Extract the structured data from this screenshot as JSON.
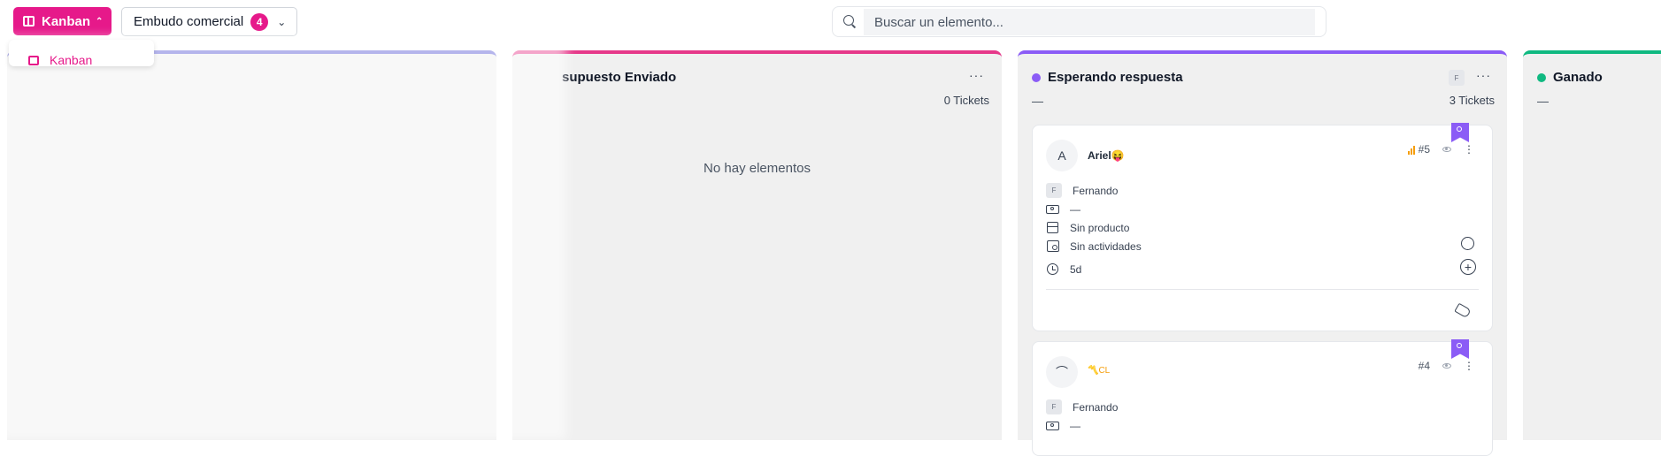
{
  "header": {
    "view_button_label": "Kanban",
    "funnel_label": "Embudo comercial",
    "funnel_count": "4",
    "search_placeholder": "Buscar un elemento..."
  },
  "dropdown": {
    "items": [
      "Kanban"
    ]
  },
  "columns": [
    {
      "title": "",
      "color": "#5b5bd6"
    },
    {
      "title": "supuesto Enviado",
      "color": "#e6398a",
      "count": "0 Tickets",
      "empty_text": "No hay elementos"
    },
    {
      "title": "Esperando respuesta",
      "color": "#8b5cf6",
      "dot": "#8b5cf6",
      "chip": "F",
      "dash": "—",
      "count": "3 Tickets"
    },
    {
      "title": "Ganado",
      "color": "#10b981",
      "dot": "#10b981",
      "dash": "—"
    }
  ],
  "cards": [
    {
      "avatar": "A",
      "name": "Ariel😝",
      "number": "#5",
      "owner_chip": "F",
      "owner": "Fernando",
      "value": "—",
      "product": "Sin producto",
      "activities": "Sin actividades",
      "age": "5d"
    },
    {
      "avatar": "⌒",
      "name": "〽️CL",
      "number": "#4",
      "owner_chip": "F",
      "owner": "Fernando",
      "value": "—"
    }
  ],
  "icons": {
    "search": "search-icon",
    "kanban": "kanban-icon",
    "chevron": "chevron-down-icon",
    "priority": "signal-bars-icon",
    "watch": "eye-icon",
    "more": "more-vertical-icon",
    "whatsapp": "whatsapp-icon",
    "add": "plus-circle-icon",
    "tag": "tags-icon",
    "bookmark": "bookmark-icon"
  }
}
